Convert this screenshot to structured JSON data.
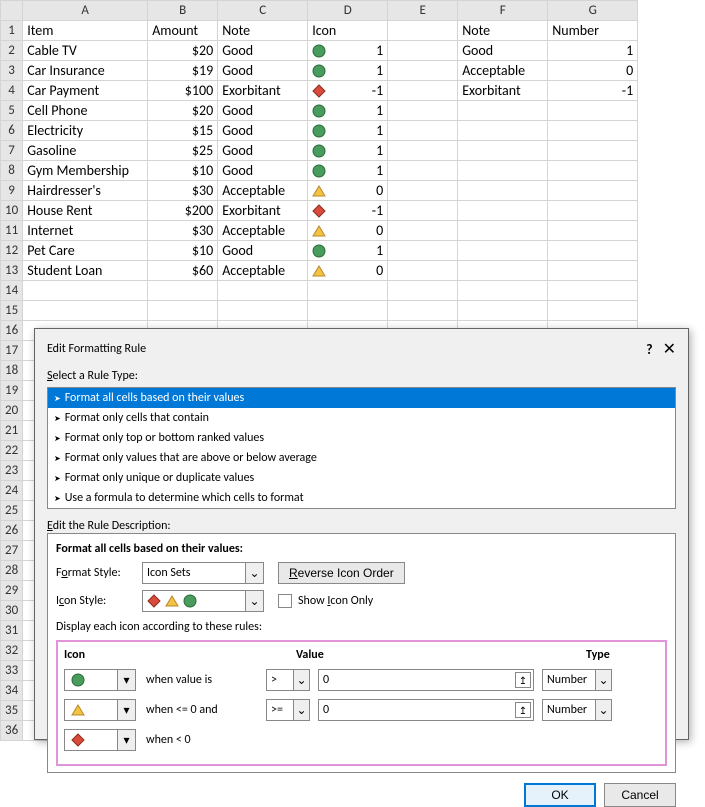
{
  "columns": [
    "A",
    "B",
    "C",
    "D",
    "E",
    "F",
    "G"
  ],
  "headers": {
    "A": "Item",
    "B": "Amount",
    "C": "Note",
    "D": "Icon",
    "F": "Note",
    "G": "Number"
  },
  "rows": [
    {
      "item": "Cable TV",
      "amount": "$20",
      "note": "Good",
      "icon": "circle",
      "val": "1"
    },
    {
      "item": "Car Insurance",
      "amount": "$19",
      "note": "Good",
      "icon": "circle",
      "val": "1"
    },
    {
      "item": "Car Payment",
      "amount": "$100",
      "note": "Exorbitant",
      "icon": "diamond",
      "val": "-1"
    },
    {
      "item": "Cell Phone",
      "amount": "$20",
      "note": "Good",
      "icon": "circle",
      "val": "1"
    },
    {
      "item": "Electricity",
      "amount": "$15",
      "note": "Good",
      "icon": "circle",
      "val": "1"
    },
    {
      "item": "Gasoline",
      "amount": "$25",
      "note": "Good",
      "icon": "circle",
      "val": "1"
    },
    {
      "item": "Gym Membership",
      "amount": "$10",
      "note": "Good",
      "icon": "circle",
      "val": "1"
    },
    {
      "item": "Hairdresser's",
      "amount": "$30",
      "note": "Acceptable",
      "icon": "triangle",
      "val": "0"
    },
    {
      "item": "House Rent",
      "amount": "$200",
      "note": "Exorbitant",
      "icon": "diamond",
      "val": "-1"
    },
    {
      "item": "Internet",
      "amount": "$30",
      "note": "Acceptable",
      "icon": "triangle",
      "val": "0"
    },
    {
      "item": "Pet Care",
      "amount": "$10",
      "note": "Good",
      "icon": "circle",
      "val": "1"
    },
    {
      "item": "Student Loan",
      "amount": "$60",
      "note": "Acceptable",
      "icon": "triangle",
      "val": "0"
    }
  ],
  "lookup": [
    {
      "note": "Good",
      "number": "1"
    },
    {
      "note": "Acceptable",
      "number": "0"
    },
    {
      "note": "Exorbitant",
      "number": "-1"
    }
  ],
  "dialog": {
    "title": "Edit Formatting Rule",
    "help": "?",
    "select_rule_label": "Select a Rule Type:",
    "rule_types": [
      "Format all cells based on their values",
      "Format only cells that contain",
      "Format only top or bottom ranked values",
      "Format only values that are above or below average",
      "Format only unique or duplicate values",
      "Use a formula to determine which cells to format"
    ],
    "edit_desc_label": "Edit the Rule Description:",
    "desc_title": "Format all cells based on their values:",
    "format_style_label": "Format Style:",
    "format_style_value": "Icon Sets",
    "reverse_label": "Reverse Icon Order",
    "icon_style_label": "Icon Style:",
    "show_icon_only_label": "Show Icon Only",
    "display_rules_label": "Display each icon according to these rules:",
    "col_icon": "Icon",
    "col_value": "Value",
    "col_type": "Type",
    "rules": [
      {
        "icon": "circle",
        "cond": "when value is",
        "op": ">",
        "value": "0",
        "type": "Number"
      },
      {
        "icon": "triangle",
        "cond": "when <= 0 and",
        "op": ">=",
        "value": "0",
        "type": "Number"
      },
      {
        "icon": "diamond",
        "cond": "when < 0"
      }
    ],
    "ok": "OK",
    "cancel": "Cancel"
  }
}
